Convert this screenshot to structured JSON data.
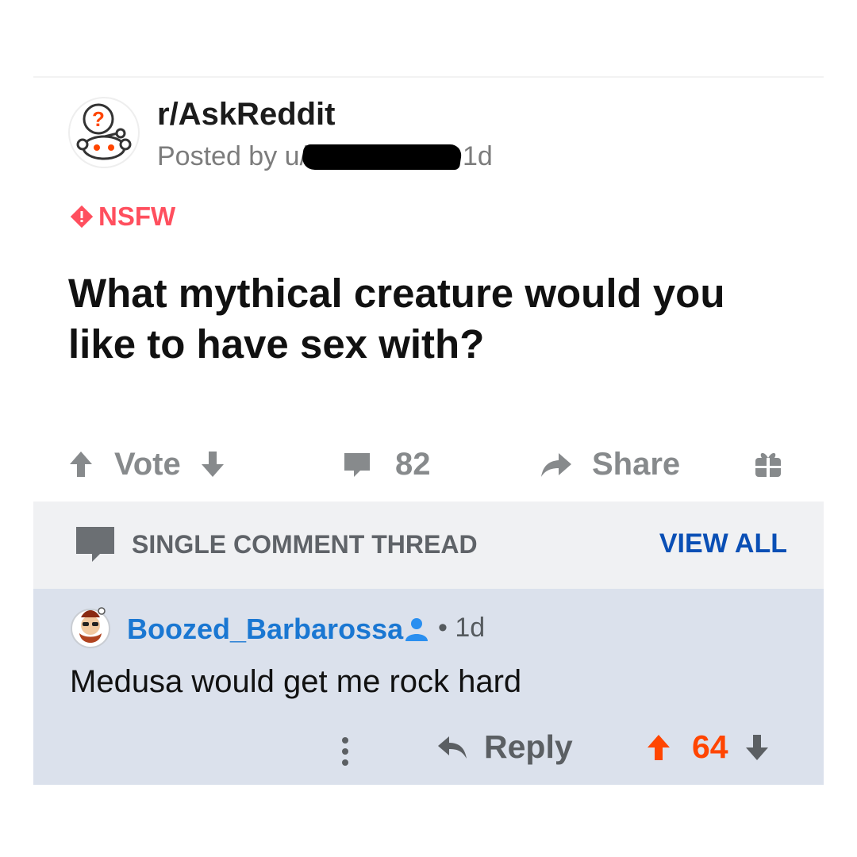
{
  "post": {
    "subreddit": "r/AskReddit",
    "posted_by_prefix": "Posted by u/",
    "age": "1d",
    "flag": "NSFW",
    "title": "What mythical creature would you like to have sex with?"
  },
  "actions": {
    "vote_label": "Vote",
    "comments_count": "82",
    "share_label": "Share"
  },
  "thread": {
    "label": "SINGLE COMMENT THREAD",
    "view_all": "VIEW ALL"
  },
  "comment": {
    "author": "Boozed_Barbarossa",
    "separator": "•",
    "age": "1d",
    "body": "Medusa would get me rock hard",
    "reply_label": "Reply",
    "score": "64"
  },
  "colors": {
    "nsfw": "#ff4f5e",
    "upvote": "#ff4500",
    "link_blue": "#0a4fb5",
    "author_blue": "#1a77d2",
    "comment_bg": "#dbe1ec",
    "thread_bg": "#f0f1f3"
  },
  "icons": {
    "subreddit_avatar": "reddit-snoo-question-icon",
    "nsfw": "warning-diamond-icon",
    "upvote": "arrow-up-icon",
    "downvote": "arrow-down-icon",
    "comments": "speech-bubble-icon",
    "share": "share-arrow-icon",
    "award": "gift-icon",
    "thread": "speech-bubble-icon",
    "op": "user-icon",
    "more": "more-vertical-icon",
    "reply": "reply-arrow-icon"
  }
}
